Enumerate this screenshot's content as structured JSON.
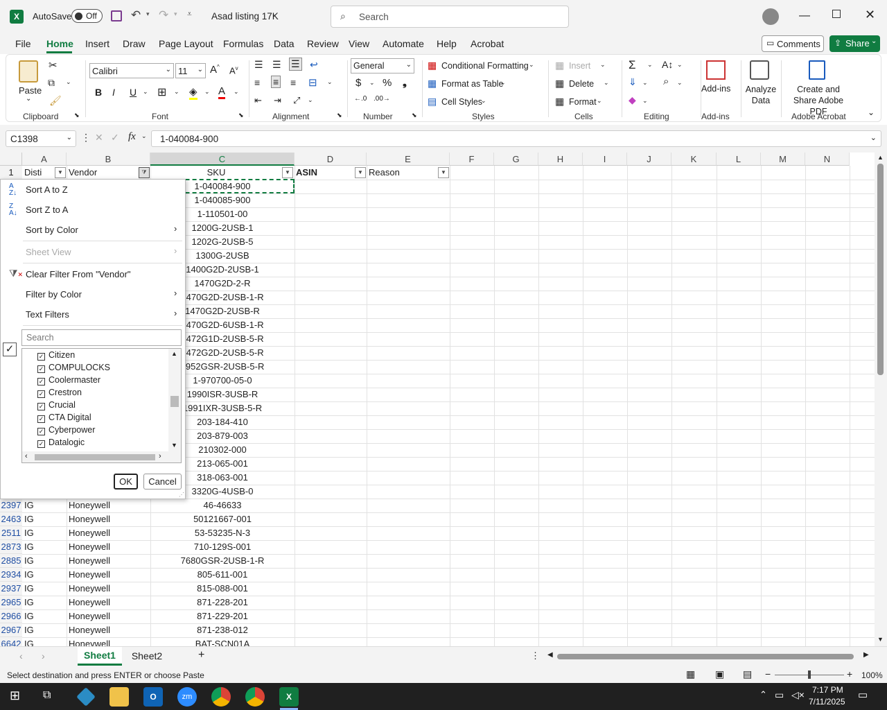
{
  "titlebar": {
    "autosave_label": "AutoSave",
    "autosave_state": "Off",
    "doc_title": "Asad listing 17K",
    "search_placeholder": "Search"
  },
  "menu": [
    "File",
    "Home",
    "Insert",
    "Draw",
    "Page Layout",
    "Formulas",
    "Data",
    "Review",
    "View",
    "Automate",
    "Help",
    "Acrobat"
  ],
  "menu_active": "Home",
  "comments_label": "Comments",
  "share_label": "Share",
  "ribbon": {
    "paste": "Paste",
    "clipboard": "Clipboard",
    "font_name": "Calibri",
    "font_size": "11",
    "font": "Font",
    "alignment": "Alignment",
    "number_format": "General",
    "number": "Number",
    "cond_format": "Conditional Formatting",
    "format_table": "Format as Table",
    "cell_styles": "Cell Styles",
    "styles": "Styles",
    "insert": "Insert",
    "delete": "Delete",
    "format": "Format",
    "cells": "Cells",
    "editing": "Editing",
    "addins": "Add-ins",
    "addins_group": "Add-ins",
    "analyze": "Analyze Data",
    "acrobat_btn": "Create and Share Adobe PDF",
    "acrobat_group": "Adobe Acrobat"
  },
  "formula": {
    "namebox": "C1398",
    "content": "1-040084-900"
  },
  "columns": [
    "A",
    "B",
    "C",
    "D",
    "E",
    "F",
    "G",
    "H",
    "I",
    "J",
    "K",
    "L",
    "M",
    "N"
  ],
  "header_row": {
    "num": "1",
    "a": "Disti",
    "b": "Vendor",
    "c": "SKU",
    "d": "ASIN",
    "e": "Reason"
  },
  "visible_sku": [
    "1-040084-900",
    "1-040085-900",
    "1-110501-00",
    "1200G-2USB-1",
    "1202G-2USB-5",
    "1300G-2USB",
    "1400G2D-2USB-1",
    "1470G2D-2-R",
    "1470G2D-2USB-1-R",
    "1470G2D-2USB-R",
    "1470G2D-6USB-1-R",
    "1472G1D-2USB-5-R",
    "1472G2D-2USB-5-R",
    "1952GSR-2USB-5-R",
    "1-970700-05-0",
    "1990ISR-3USB-R",
    "1991IXR-3USB-5-R",
    "203-184-410",
    "203-879-003",
    "210302-000",
    "213-065-001",
    "318-063-001",
    "3320G-4USB-0"
  ],
  "rows": [
    {
      "num": "2397",
      "a": "IG",
      "b": "Honeywell",
      "c": "46-46633"
    },
    {
      "num": "2463",
      "a": "IG",
      "b": "Honeywell",
      "c": "50121667-001"
    },
    {
      "num": "2511",
      "a": "IG",
      "b": "Honeywell",
      "c": "53-53235-N-3"
    },
    {
      "num": "2873",
      "a": "IG",
      "b": "Honeywell",
      "c": "710-129S-001"
    },
    {
      "num": "2885",
      "a": "IG",
      "b": "Honeywell",
      "c": "7680GSR-2USB-1-R"
    },
    {
      "num": "2934",
      "a": "IG",
      "b": "Honeywell",
      "c": "805-611-001"
    },
    {
      "num": "2937",
      "a": "IG",
      "b": "Honeywell",
      "c": "815-088-001"
    },
    {
      "num": "2965",
      "a": "IG",
      "b": "Honeywell",
      "c": "871-228-201"
    },
    {
      "num": "2966",
      "a": "IG",
      "b": "Honeywell",
      "c": "871-229-201"
    },
    {
      "num": "2967",
      "a": "IG",
      "b": "Honeywell",
      "c": "871-238-012"
    },
    {
      "num": "6642",
      "a": "IG",
      "b": "Honeywell",
      "c": "BAT-SCN01A"
    }
  ],
  "dropdown": {
    "sort_az": "Sort A to Z",
    "sort_za": "Sort Z to A",
    "sort_color": "Sort by Color",
    "sheet_view": "Sheet View",
    "clear_filter": "Clear Filter From \"Vendor\"",
    "filter_color": "Filter by Color",
    "text_filters": "Text Filters",
    "search_placeholder": "Search",
    "items": [
      "Citizen",
      "COMPULOCKS",
      "Coolermaster",
      "Crestron",
      "Crucial",
      "CTA Digital",
      "Cyberpower",
      "Datalogic"
    ],
    "ok": "OK",
    "cancel": "Cancel"
  },
  "sheets": [
    "Sheet1",
    "Sheet2"
  ],
  "active_sheet": "Sheet1",
  "status": {
    "message": "Select destination and press ENTER or choose Paste",
    "zoom": "100%"
  },
  "taskbar": {
    "time": "7:17 PM",
    "date": "7/11/2025"
  },
  "colors": {
    "excel_green": "#107c41",
    "accent": "#185abd"
  }
}
